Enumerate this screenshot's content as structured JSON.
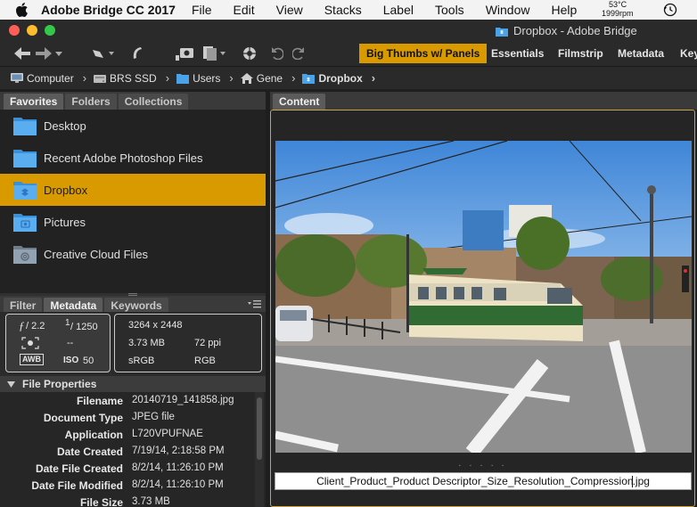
{
  "menubar": {
    "app_name": "Adobe Bridge CC 2017",
    "items": [
      "File",
      "Edit",
      "View",
      "Stacks",
      "Label",
      "Tools",
      "Window",
      "Help"
    ],
    "status_temp": "53°C",
    "status_rpm": "1999rpm",
    "icons": [
      "apple-icon",
      "time-machine-icon"
    ]
  },
  "window": {
    "title": "Dropbox - Adobe Bridge",
    "traffic_lights": {
      "close": "#fc5f57",
      "minimize": "#fdbc2e",
      "zoom": "#34c84a"
    }
  },
  "toolbar": {
    "workspaces": [
      "Big Thumbs w/ Panels",
      "Essentials",
      "Filmstrip",
      "Metadata",
      "Key"
    ],
    "active_workspace": "Big Thumbs w/ Panels",
    "accent": "#d99a00"
  },
  "path": [
    {
      "label": "Computer",
      "icon": "computer-icon"
    },
    {
      "label": "BRS SSD",
      "icon": "drive-icon"
    },
    {
      "label": "Users",
      "icon": "folder-icon"
    },
    {
      "label": "Gene",
      "icon": "home-icon"
    },
    {
      "label": "Dropbox",
      "icon": "dropbox-folder-icon"
    }
  ],
  "left_tabs": [
    "Favorites",
    "Folders",
    "Collections"
  ],
  "favorites": [
    {
      "label": "Desktop",
      "icon": "folder-icon"
    },
    {
      "label": "Recent Adobe Photoshop Files",
      "icon": "folder-icon"
    },
    {
      "label": "Dropbox",
      "icon": "dropbox-folder-icon",
      "selected": true
    },
    {
      "label": "Pictures",
      "icon": "pictures-folder-icon"
    },
    {
      "label": "Creative Cloud Files",
      "icon": "creative-cloud-folder-icon"
    }
  ],
  "meta_tabs": [
    "Filter",
    "Metadata",
    "Keywords"
  ],
  "camera": {
    "aperture_f": "ƒ",
    "aperture": "/ 2.2",
    "shutter_num": "1",
    "shutter_den": "/ 1250",
    "metering": "--",
    "awb": "AWB",
    "iso_label": "ISO",
    "iso": "50"
  },
  "file_summary": {
    "dimensions": "3264 x 2448",
    "size": "3.73 MB",
    "resolution": "72 ppi",
    "color_profile": "sRGB",
    "color_mode": "RGB"
  },
  "file_properties": {
    "title": "File Properties",
    "rows": [
      {
        "key": "Filename",
        "value": "20140719_141858.jpg"
      },
      {
        "key": "Document Type",
        "value": "JPEG file"
      },
      {
        "key": "Application",
        "value": "L720VPUFNAE"
      },
      {
        "key": "Date Created",
        "value": "7/19/14, 2:18:58 PM"
      },
      {
        "key": "Date File Created",
        "value": "8/2/14, 11:26:10 PM"
      },
      {
        "key": "Date File Modified",
        "value": "8/2/14, 11:26:10 PM"
      },
      {
        "key": "File Size",
        "value": "3.73 MB"
      }
    ]
  },
  "content": {
    "tab": "Content",
    "dots": ". . . . .",
    "filename_value": "Client_Product_Product Descriptor_Size_Resolution_Compression.jpg"
  }
}
